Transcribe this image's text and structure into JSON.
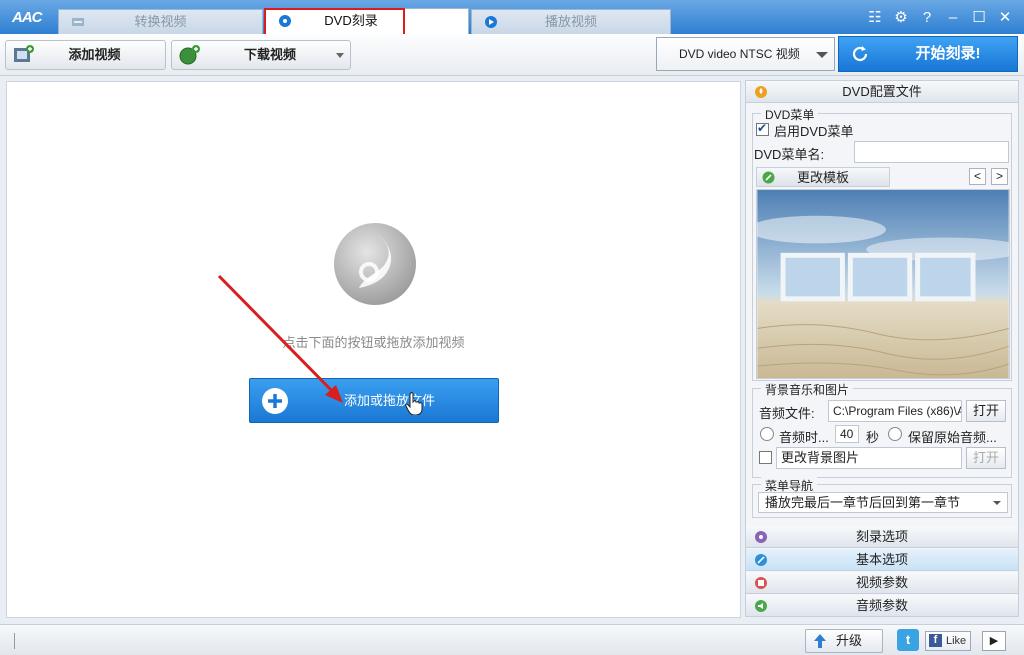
{
  "app": {
    "logo": "AAC"
  },
  "tabs": [
    {
      "label": "转换视频",
      "active": false
    },
    {
      "label": "DVD刻录",
      "active": true
    },
    {
      "label": "播放视频",
      "active": false
    }
  ],
  "toolbar": {
    "add_video": "添加视频",
    "download_video": "下载视频",
    "format": "DVD video NTSC 视频",
    "start_burn": "开始刻录!"
  },
  "main": {
    "hint": "点击下面的按钮或拖放添加视频",
    "add_or_drop": "添加或拖放文件"
  },
  "side": {
    "profile_header": "DVD配置文件",
    "dvd_menu": {
      "legend": "DVD菜单",
      "enable_label": "启用DVD菜单",
      "enabled": true,
      "name_label": "DVD菜单名:",
      "name_value": ""
    },
    "template": {
      "label": "更改模板",
      "prev": "<",
      "next": ">"
    },
    "bg": {
      "legend": "背景音乐和图片",
      "audio_label": "音频文件:",
      "audio_path": "C:\\Program Files (x86)\\A",
      "open": "打开",
      "duration_label": "音频时...",
      "duration_value": "40",
      "seconds": "秒",
      "keep_original": "保留原始音频...",
      "change_bg_image": "更改背景图片",
      "open_disabled": "打开"
    },
    "nav": {
      "legend": "菜单导航",
      "selected": "播放完最后一章节后回到第一章节"
    },
    "sections": [
      "刻录选项",
      "基本选项",
      "视频参数",
      "音频参数"
    ]
  },
  "statusbar": {
    "upgrade": "升级",
    "twitter": "t",
    "fb_like": "Like"
  },
  "colors": {
    "accent": "#1b78d4",
    "highlight_box": "#e01a1a",
    "arrow": "#d81e1e"
  }
}
